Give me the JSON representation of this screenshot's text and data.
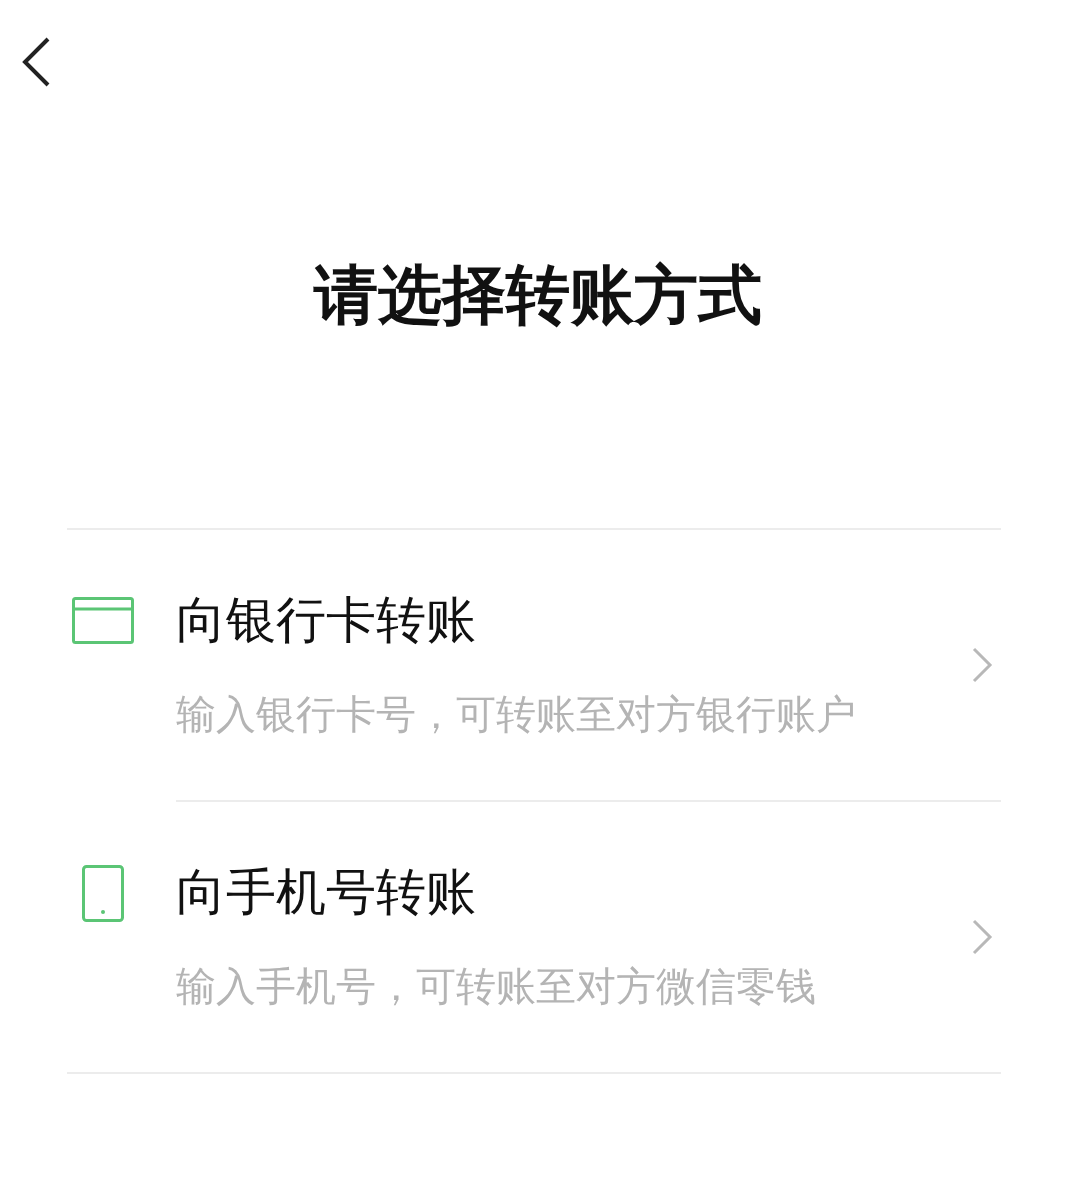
{
  "title": "请选择转账方式",
  "options": [
    {
      "kind": "bank_card",
      "title": "向银行卡转账",
      "description": "输入银行卡号，可转账至对方银行账户"
    },
    {
      "kind": "phone",
      "title": "向手机号转账",
      "description": "输入手机号，可转账至对方微信零钱"
    }
  ]
}
